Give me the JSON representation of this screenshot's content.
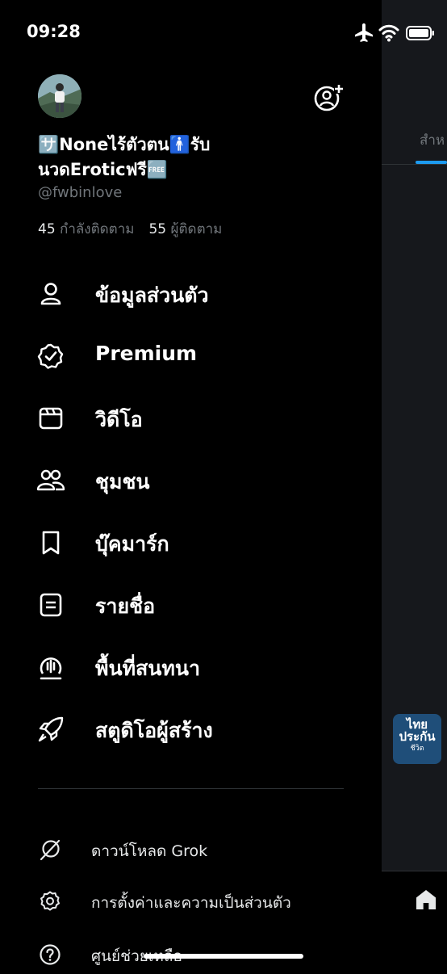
{
  "status_bar": {
    "time": "09:28"
  },
  "background": {
    "tab_label": "สำห",
    "thumb_lines": [
      "ไทย",
      "ประกัน",
      "ชีวิต"
    ]
  },
  "profile": {
    "display_name": "🈂️Noneไร้ตัวตน🚹รับนวดEroticฟรี🆓",
    "handle": "@fwbinlove",
    "following_count": "45",
    "following_label": "กำลังติดตาม",
    "followers_count": "55",
    "followers_label": "ผู้ติดตาม"
  },
  "menu": [
    {
      "label": "ข้อมูลส่วนตัว",
      "icon": "person-icon"
    },
    {
      "label": "Premium",
      "icon": "verified-badge-icon"
    },
    {
      "label": "วิดีโอ",
      "icon": "video-icon"
    },
    {
      "label": "ชุมชน",
      "icon": "communities-icon"
    },
    {
      "label": "บุ๊คมาร์ก",
      "icon": "bookmark-icon"
    },
    {
      "label": "รายชื่อ",
      "icon": "list-icon"
    },
    {
      "label": "พื้นที่สนทนา",
      "icon": "spaces-icon"
    },
    {
      "label": "สตูดิโอผู้สร้าง",
      "icon": "rocket-icon"
    }
  ],
  "secondary": [
    {
      "label": "ดาวน์โหลด Grok",
      "icon": "grok-icon"
    },
    {
      "label": "การตั้งค่าและความเป็นส่วนตัว",
      "icon": "gear-icon"
    },
    {
      "label": "ศูนย์ช่วยเหลือ",
      "icon": "help-icon"
    }
  ]
}
